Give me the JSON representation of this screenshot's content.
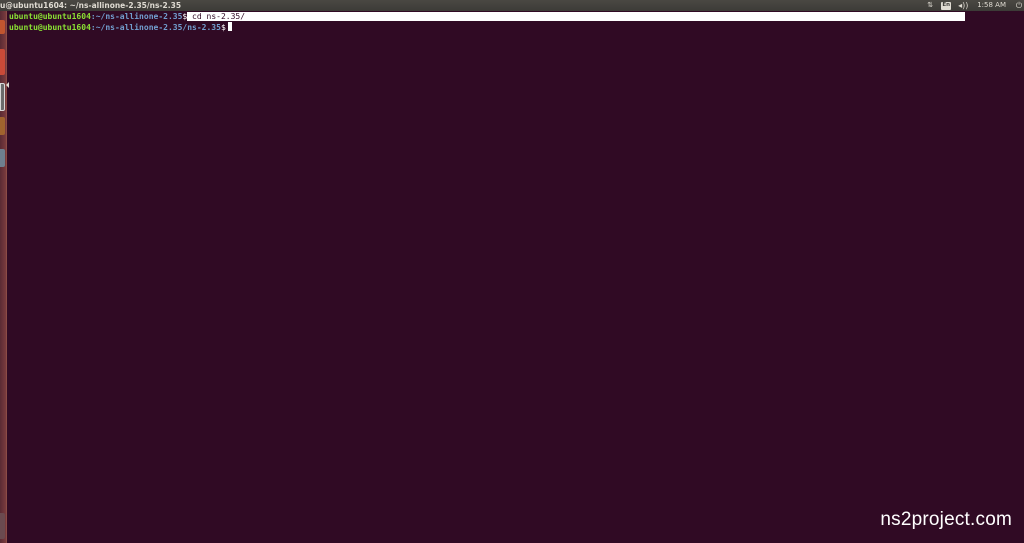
{
  "window": {
    "title": "u@ubuntu1604: ~/ns-allinone-2.35/ns-2.35"
  },
  "indicators": {
    "network_icon": "network-updown-icon",
    "network_glyph": "⇅",
    "keyboard_label": "En",
    "volume_icon": "speaker-icon",
    "volume_glyph": "◂))",
    "clock": "1:58 AM",
    "session_icon": "power-gear-icon",
    "session_glyph": "⏻"
  },
  "terminal": {
    "lines": [
      {
        "user": "ubuntu@ubuntu1604",
        "path": ":~/ns-allinone-2.35",
        "sign": "$",
        "command": " cd ns-2.35/"
      },
      {
        "user": "ubuntu@ubuntu1604",
        "path": ":~/ns-allinone-2.35/ns-2.35",
        "sign": "$",
        "command": " "
      }
    ]
  },
  "watermark": "ns2project.com",
  "colors": {
    "background": "#300a24",
    "prompt_user": "#8ae234",
    "prompt_path": "#729fcf",
    "panel": "#3c3b37"
  }
}
